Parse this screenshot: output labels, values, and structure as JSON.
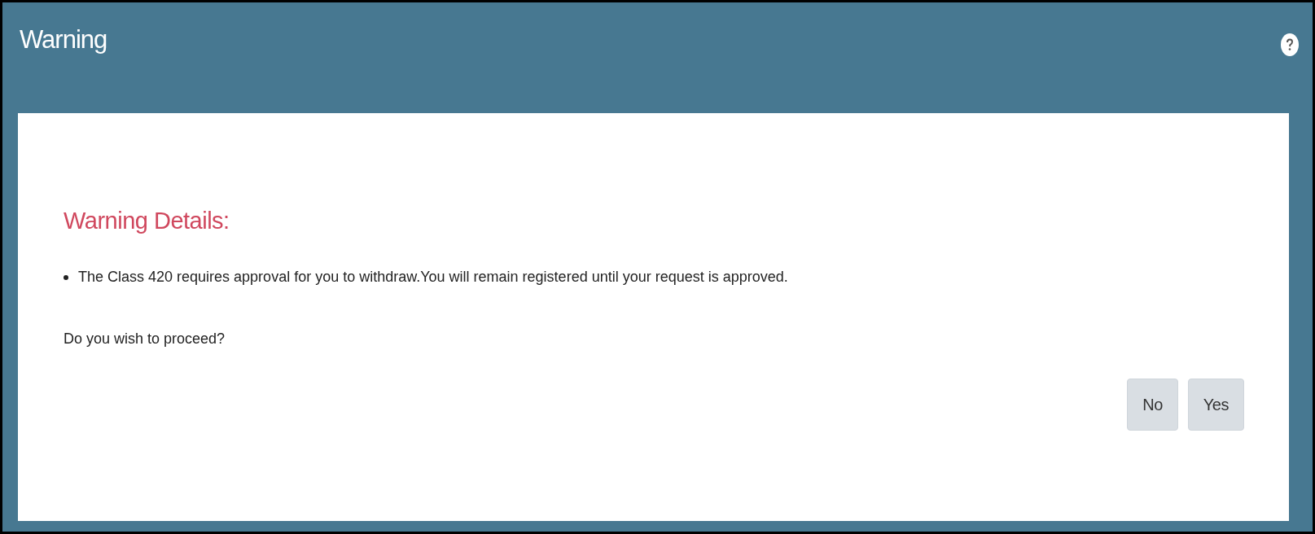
{
  "dialog": {
    "title": "Warning",
    "heading": "Warning Details:",
    "messages": [
      "The Class 420 requires approval for you to withdraw.You will remain registered until your request is approved."
    ],
    "question": "Do you wish to proceed?",
    "buttons": [
      "No",
      "Yes"
    ]
  }
}
